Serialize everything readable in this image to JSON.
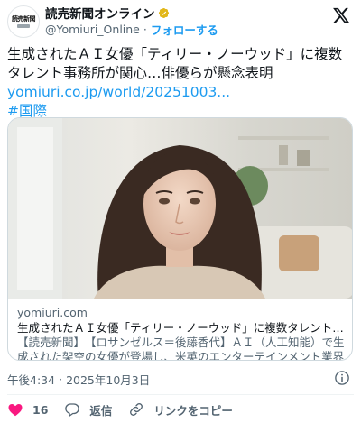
{
  "author": {
    "logo_text": "読売新聞",
    "name": "読売新聞オンライン",
    "handle": "@Yomiuri_Online",
    "separator": "·",
    "follow_label": "フォローする"
  },
  "tweet": {
    "text": "生成されたＡＩ女優「ティリー・ノーウッド」に複数タレント事務所が関心…俳優らが懸念表明",
    "link": "yomiuri.co.jp/world/20251003...",
    "hashtag": "#国際"
  },
  "card": {
    "domain": "yomiuri.com",
    "title": "生成されたＡＩ女優「ティリー・ノーウッド」に複数タレント事務所...",
    "description": "【読売新聞】　【ロサンゼルス＝後藤香代】ＡＩ（人工知能）で生成された架空の女優が登場し、米英のエンターテインメント業界で論争を..."
  },
  "meta": {
    "time": "午後4:34",
    "separator": "·",
    "date": "2025年10月3日"
  },
  "actions": {
    "like_count": "16",
    "reply_label": "返信",
    "copy_link_label": "リンクをコピー"
  },
  "colors": {
    "accent": "#1d9bf0",
    "like": "#f91880",
    "muted": "#536471",
    "verified": "#e2b719"
  }
}
